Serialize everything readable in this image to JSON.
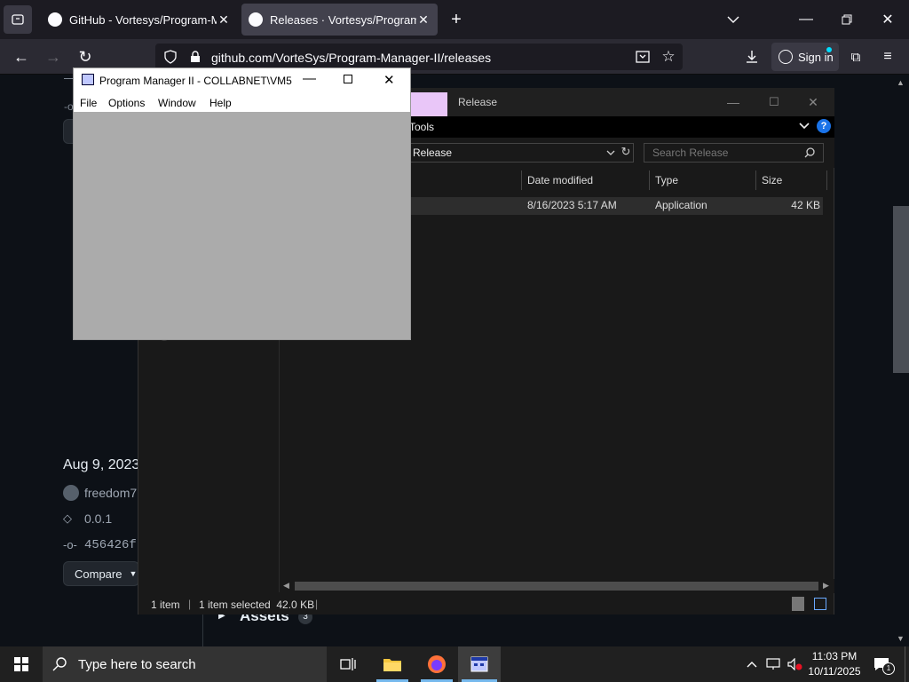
{
  "browser": {
    "tabs": [
      {
        "title": "GitHub - Vortesys/Program-Ma",
        "active": false
      },
      {
        "title": "Releases · Vortesys/Program-M",
        "active": true
      }
    ],
    "url": "github.com/VorteSys/Program-Manager-II/releases",
    "sign_in": "Sign in"
  },
  "github_page": {
    "date": "Aug 9, 2023",
    "author": "freedom7",
    "tag": "0.0.1",
    "commit": "456426f",
    "compare_label": "Compare",
    "assets_label": "Assets",
    "assets_count": "3"
  },
  "explorer": {
    "title": "Release",
    "ribbon_tab": "Tools",
    "address": "Release",
    "search_placeholder": "Search Release",
    "columns": [
      "Date modified",
      "Type",
      "Size"
    ],
    "file": {
      "date": "8/16/2023 5:17 AM",
      "type": "Application",
      "size": "42 KB"
    },
    "status": {
      "count": "1 item",
      "selected": "1 item selected  42.0 KB"
    }
  },
  "program_manager": {
    "title": "Program Manager II - COLLABNET\\VM5",
    "menu": [
      "File",
      "Options",
      "Window",
      "Help"
    ]
  },
  "taskbar": {
    "search_placeholder": "Type here to search",
    "time": "11:03 PM",
    "date": "10/11/2025",
    "notification_count": "1"
  }
}
